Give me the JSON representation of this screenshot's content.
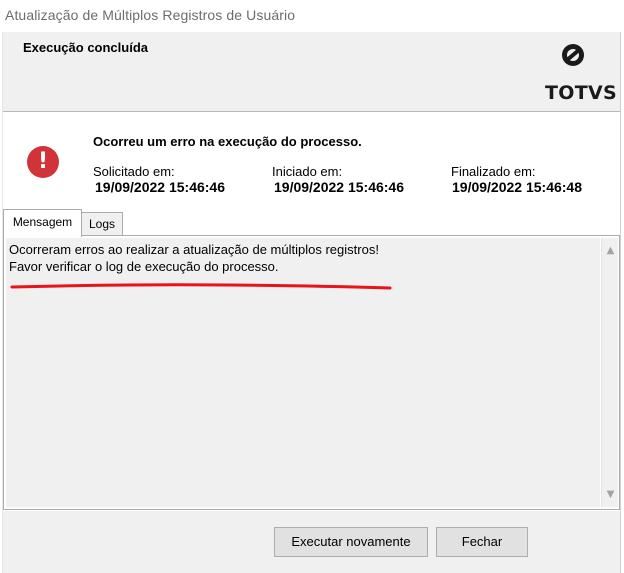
{
  "window": {
    "title": "Atualização de Múltiplos Registros de Usuário"
  },
  "header": {
    "heading": "Execução concluída",
    "logo_text": "TOTVS"
  },
  "status": {
    "error_message": "Ocorreu um erro na execução do processo.",
    "error_icon": "error-icon",
    "requested": {
      "label": "Solicitado em:",
      "value": "19/09/2022 15:46:46"
    },
    "started": {
      "label": "Iniciado em:",
      "value": "19/09/2022 15:46:46"
    },
    "finished": {
      "label": "Finalizado em:",
      "value": "19/09/2022 15:46:48"
    }
  },
  "tabs": [
    {
      "label": "Mensagem",
      "active": true
    },
    {
      "label": "Logs",
      "active": false
    }
  ],
  "message": {
    "lines": [
      "Ocorreram erros ao realizar a atualização de múltiplos registros!",
      "Favor verificar o log de execução do processo."
    ],
    "underline_color": "#e8141a"
  },
  "buttons": {
    "retry": "Executar novamente",
    "close": "Fechar"
  },
  "colors": {
    "error": "#d13438",
    "panel_bg": "#f0f0f0",
    "button_bg": "#e1e1e1"
  }
}
